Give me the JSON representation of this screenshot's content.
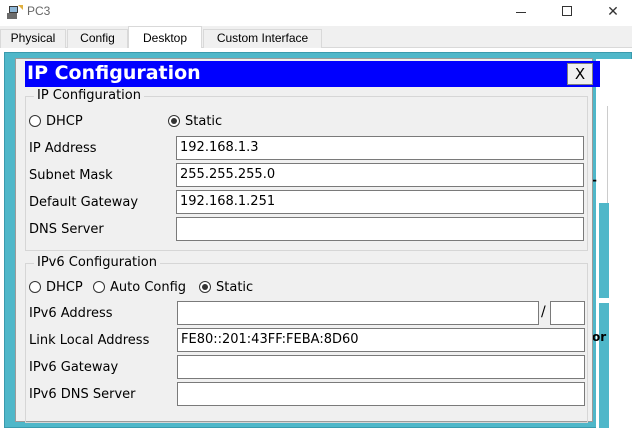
{
  "window": {
    "title": "PC3",
    "minimize": "—",
    "close": "✕"
  },
  "tabs": [
    {
      "label": "Physical"
    },
    {
      "label": "Config"
    },
    {
      "label": "Desktop"
    },
    {
      "label": "Custom Interface"
    }
  ],
  "dialog": {
    "title": "IP Configuration",
    "close_label": "X"
  },
  "ipv4": {
    "legend": "IP Configuration",
    "dhcp_label": "DHCP",
    "static_label": "Static",
    "selected": "Static",
    "fields": [
      {
        "label": "IP Address",
        "value": "192.168.1.3"
      },
      {
        "label": "Subnet Mask",
        "value": "255.255.255.0"
      },
      {
        "label": "Default Gateway",
        "value": "192.168.1.251"
      },
      {
        "label": "DNS Server",
        "value": ""
      }
    ]
  },
  "ipv6": {
    "legend": "IPv6 Configuration",
    "dhcp_label": "DHCP",
    "auto_label": "Auto Config",
    "static_label": "Static",
    "selected": "Static",
    "address_label": "IPv6 Address",
    "address_value": "",
    "prefix_value": "",
    "slash": "/",
    "link_local_label": "Link Local Address",
    "link_local_value": "FE80::201:43FF:FEBA:8D60",
    "gateway_label": "IPv6 Gateway",
    "gateway_value": "",
    "dns_label": "IPv6 DNS Server",
    "dns_value": ""
  },
  "background_fragments": {
    "text1": "-",
    "text2": "or"
  },
  "colors": {
    "dialog_header": "#0000ff",
    "desktop_bg": "#4fb7c9"
  }
}
